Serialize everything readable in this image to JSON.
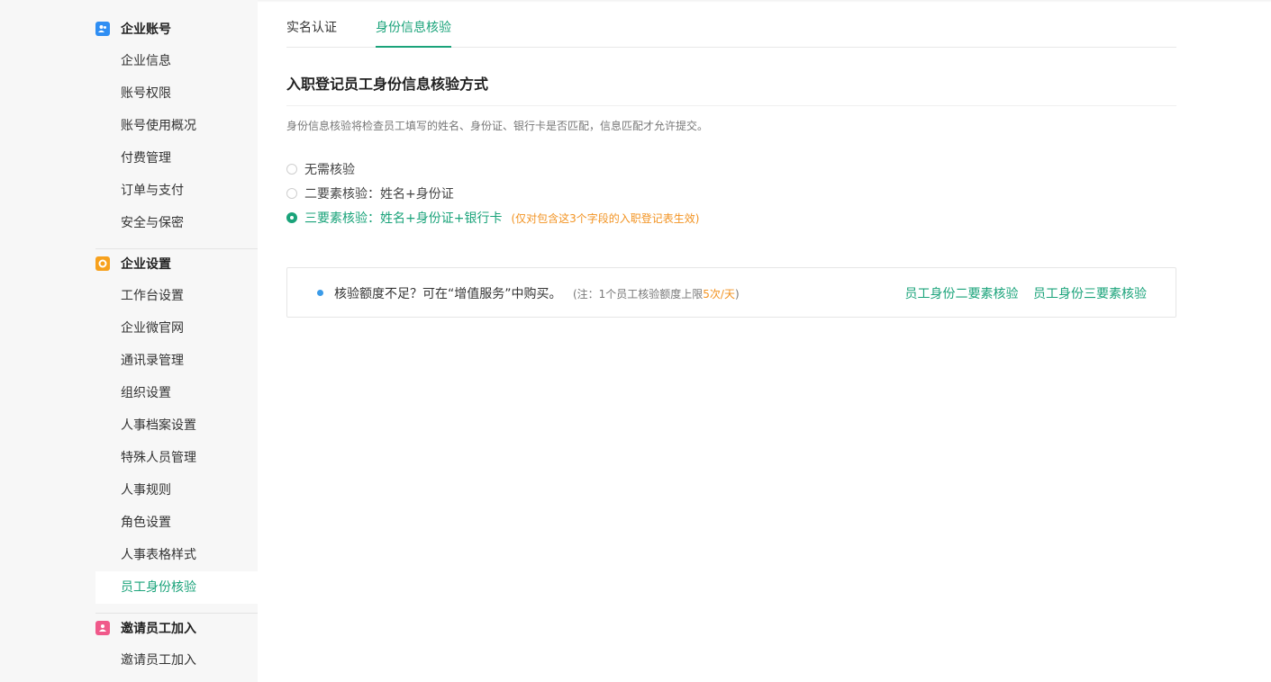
{
  "sidebar": {
    "groups": [
      {
        "title": "企业账号",
        "icon": "enterprise-account-icon",
        "icon_color": "#2f8ef3",
        "items": [
          "企业信息",
          "账号权限",
          "账号使用概况",
          "付费管理",
          "订单与支付",
          "安全与保密"
        ]
      },
      {
        "title": "企业设置",
        "icon": "enterprise-settings-icon",
        "icon_color": "#f7a11d",
        "items": [
          "工作台设置",
          "企业微官网",
          "通讯录管理",
          "组织设置",
          "人事档案设置",
          "特殊人员管理",
          "人事规则",
          "角色设置",
          "人事表格样式",
          "员工身份核验"
        ]
      },
      {
        "title": "邀请员工加入",
        "icon": "invite-employee-icon",
        "icon_color": "#f0598a",
        "items": [
          "邀请员工加入"
        ]
      }
    ],
    "active_item": "员工身份核验"
  },
  "tabs": [
    {
      "label": "实名认证",
      "active": false
    },
    {
      "label": "身份信息核验",
      "active": true
    }
  ],
  "section": {
    "title": "入职登记员工身份信息核验方式",
    "description": "身份信息核验将检查员工填写的姓名、身份证、银行卡是否匹配，信息匹配才允许提交。"
  },
  "options": [
    {
      "label": "无需核验",
      "checked": false
    },
    {
      "label": "二要素核验：姓名+身份证",
      "checked": false
    },
    {
      "label": "三要素核验：姓名+身份证+银行卡",
      "checked": true,
      "note": "(仅对包含这3个字段的入职登记表生效)"
    }
  ],
  "quota": {
    "message": "核验额度不足？可在“增值服务”中购买。",
    "note_prefix": "(注：1个员工核验额度上限",
    "note_highlight": "5次/天",
    "note_suffix": ")",
    "links": [
      "员工身份二要素核验",
      "员工身份三要素核验"
    ]
  },
  "colors": {
    "accent": "#1aa37a",
    "warning": "#f29322",
    "info_dot": "#3b9be8"
  }
}
